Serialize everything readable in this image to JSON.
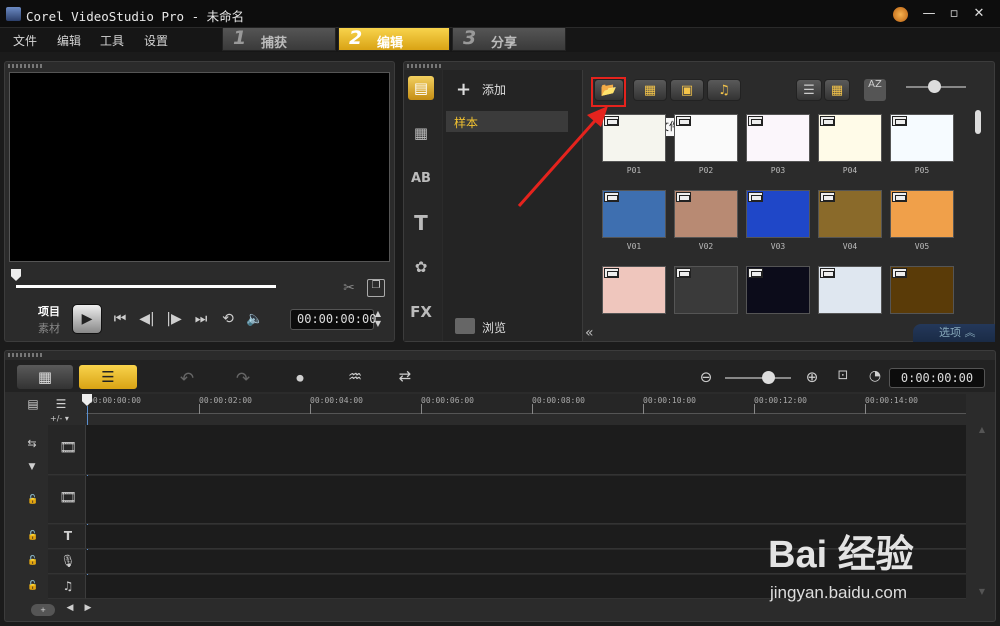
{
  "window": {
    "title": "Corel VideoStudio Pro - 未命名"
  },
  "menu": [
    "文件",
    "编辑",
    "工具",
    "设置"
  ],
  "steps": [
    {
      "num": "1",
      "label": "捕获"
    },
    {
      "num": "2",
      "label": "编辑"
    },
    {
      "num": "3",
      "label": "分享"
    }
  ],
  "player": {
    "project_label": "项目",
    "clip_label": "素材",
    "timecode": "00:00:00:00"
  },
  "library": {
    "add_label": "添加",
    "folder": "样本",
    "browse_label": "浏览",
    "tooltip": "导入媒体文件",
    "options_label": "选项",
    "thumbnails": [
      {
        "label": "P01",
        "color": "#f5f5ee"
      },
      {
        "label": "P02",
        "color": "#fafafa"
      },
      {
        "label": "P03",
        "color": "#fbf6fb"
      },
      {
        "label": "P04",
        "color": "#fffbe8"
      },
      {
        "label": "P05",
        "color": "#f6fbff"
      },
      {
        "label": "V01",
        "color": "#3e6fb0"
      },
      {
        "label": "V02",
        "color": "#b88a73"
      },
      {
        "label": "V03",
        "color": "#1f47c8"
      },
      {
        "label": "V04",
        "color": "#8a6a2a"
      },
      {
        "label": "V05",
        "color": "#f0a04a"
      },
      {
        "label": "",
        "color": "#efc6bd"
      },
      {
        "label": "",
        "color": "#3a3a3a"
      },
      {
        "label": "",
        "color": "#0c0c1a"
      },
      {
        "label": "",
        "color": "#dfe7f0"
      },
      {
        "label": "",
        "color": "#5a3b08"
      }
    ]
  },
  "timeline": {
    "timecode": "0:00:00:00",
    "ruler": [
      "00:00:00:00",
      "00:00:02:00",
      "00:00:04:00",
      "00:00:06:00",
      "00:00:08:00",
      "00:00:10:00",
      "00:00:12:00",
      "00:00:14:00"
    ],
    "track_add_label": "+/- ▾"
  },
  "colors": {
    "accent": "#f2c230",
    "annotation": "#e5231d"
  },
  "watermark": {
    "brand": "Bai 经验",
    "url": "jingyan.baidu.com"
  }
}
